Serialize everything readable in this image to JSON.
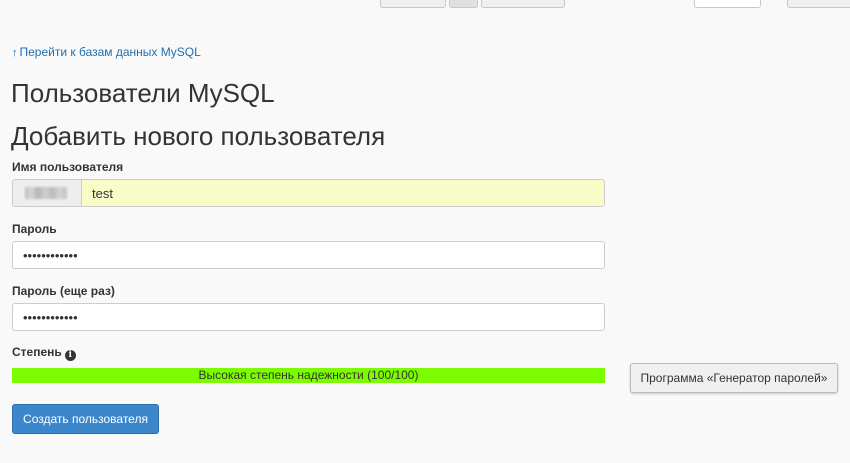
{
  "navigation": {
    "back_link": "Перейти к базам данных MySQL"
  },
  "page": {
    "title": "Пользователи MySQL",
    "section_title": "Добавить нового пользователя"
  },
  "form": {
    "username_label": "Имя пользователя",
    "username_value": "test",
    "password_label": "Пароль",
    "password_value": "••••••••••••",
    "password_repeat_label": "Пароль (еще раз)",
    "password_repeat_value": "••••••••••••",
    "strength_label": "Степень",
    "strength_text": "Высокая степень надежности (100/100)",
    "strength_percent": 100,
    "strength_color": "#7cfc00",
    "generator_button": "Программа «Генератор паролей»",
    "create_button": "Создать пользователя"
  },
  "colors": {
    "link": "#1f6fb2",
    "primary_button": "#3a87cc",
    "username_field_bg": "#fafcc8"
  },
  "icons": {
    "back": "arrow-up",
    "strength_info": "info-circle"
  }
}
